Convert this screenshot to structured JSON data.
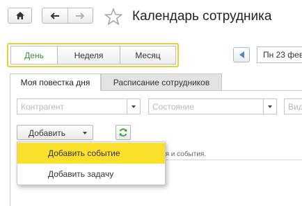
{
  "window": {
    "title": "Календарь сотрудника"
  },
  "nav": {
    "home_icon": "home-icon",
    "back_icon": "arrow-left-icon",
    "forward_icon": "arrow-right-icon",
    "favorite_icon": "star-icon"
  },
  "period": {
    "options": [
      "День",
      "Неделя",
      "Месяц"
    ],
    "selected": "День",
    "accent_color": "#3c8a3c"
  },
  "date": {
    "prev_icon": "arrow-left-icon",
    "value": "Пн 23 фев"
  },
  "tabs": [
    {
      "label": "Моя повестка дня",
      "active": true
    },
    {
      "label": "Расписание сотрудников",
      "active": false
    }
  ],
  "filters": {
    "counterparty_placeholder": "Контрагент",
    "state_placeholder": "Состояние",
    "view_placeholder": "Вид"
  },
  "toolbar": {
    "add_label": "Добавить",
    "refresh_icon": "refresh-icon"
  },
  "add_menu": {
    "items": [
      {
        "label": "Добавить событие",
        "highlighted": true
      },
      {
        "label": "Добавить задачу",
        "highlighted": false
      }
    ],
    "highlight_color": "#fbe02b"
  },
  "content": {
    "hint_fragment": "ия и события."
  }
}
